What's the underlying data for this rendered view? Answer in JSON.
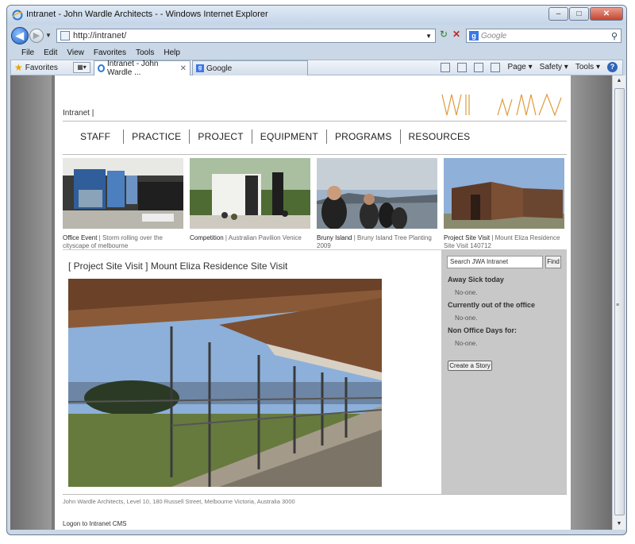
{
  "window": {
    "title": "Intranet - John Wardle Architects - - Windows Internet Explorer",
    "minimize": "–",
    "maximize": "□",
    "close": "✕"
  },
  "toolbar": {
    "back": "◀",
    "forward": "▶",
    "address_url": "http://intranet/",
    "search_placeholder": "Google",
    "refresh": "↻",
    "stop": "✕",
    "search_glyph": "⚲"
  },
  "menu": [
    "File",
    "Edit",
    "View",
    "Favorites",
    "Tools",
    "Help"
  ],
  "favbar": {
    "favorites_label": "Favorites",
    "tabs": [
      {
        "label": "Intranet - John Wardle ...",
        "close": "✕"
      },
      {
        "label": "Google"
      }
    ],
    "commands": [
      "Page",
      "Safety",
      "Tools"
    ],
    "help": "?"
  },
  "page": {
    "breadcrumb": "Intranet |",
    "nav": [
      "STAFF",
      "PRACTICE",
      "PROJECT",
      "EQUIPMENT",
      "PROGRAMS",
      "RESOURCES"
    ],
    "thumbs": [
      {
        "bold": "Office Event",
        "text": " | Storm rolling over the cityscape of melbourne"
      },
      {
        "bold": "Competition",
        "text": " | Australian Pavilion Venice"
      },
      {
        "bold": "Bruny Island",
        "text": " | Bruny Island Tree Planting 2009"
      },
      {
        "bold": "Project Site Visit",
        "text": " | Mount Eliza Residence Site Visit 140712"
      }
    ],
    "story_title": "[ Project Site Visit ] Mount Eliza Residence Site Visit",
    "sidebar": {
      "search_value": "Search JWA Intranet",
      "find_label": "Find",
      "away_heading": "Away Sick today",
      "away_value": "No-one.",
      "out_heading": "Currently out of the office",
      "out_value": "No-one.",
      "nonoffice_heading": "Non Office Days for:",
      "nonoffice_value": "No-one.",
      "create_label": "Create a Story"
    },
    "footer": "John Wardle Architects, Level 10, 180 Russell Street, Melbourne Victoria, Australia 3000",
    "cms_link": "Logon to Intranet CMS"
  },
  "colors": {
    "accent_logo": "#e09a3c",
    "sidebar_bg": "#c8c8c8"
  }
}
